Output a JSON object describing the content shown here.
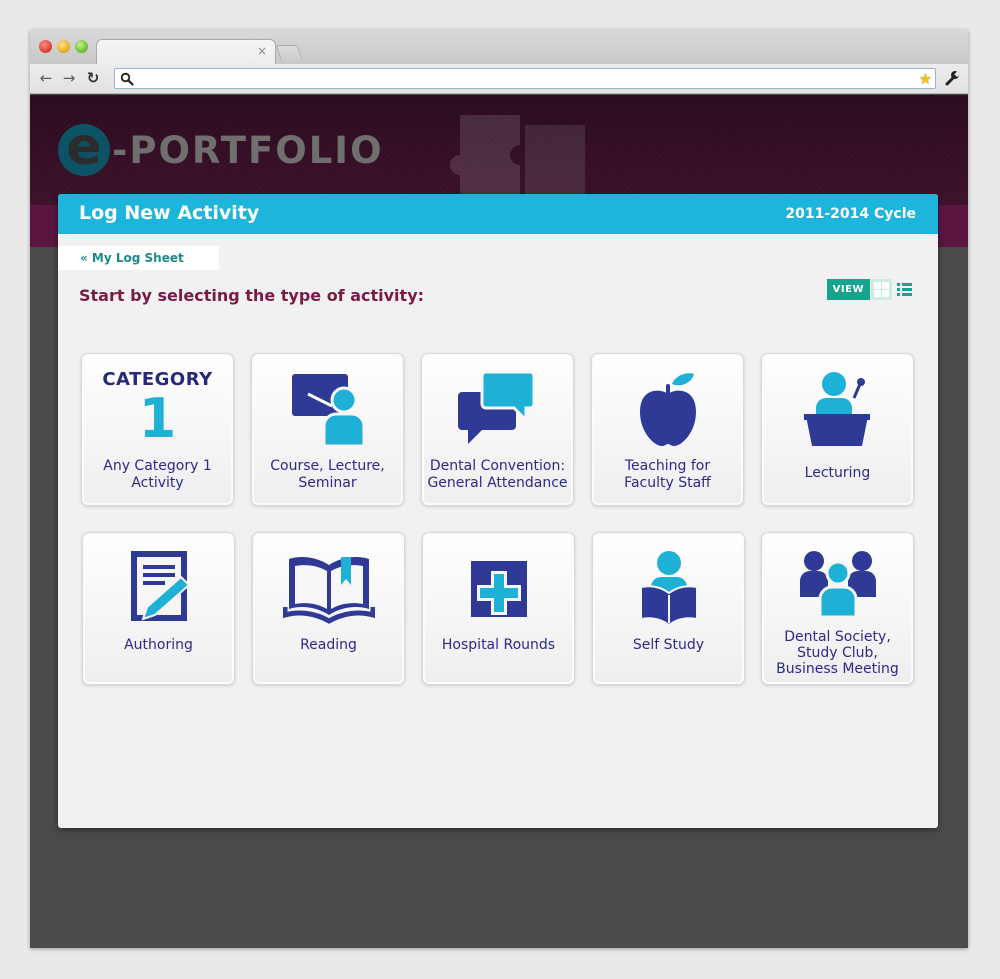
{
  "browser": {
    "tab_close": "×",
    "address": "",
    "buttons": {
      "back": "←",
      "forward": "→",
      "reload": "↻"
    },
    "star": "★"
  },
  "hero": {
    "logo_letter": "e",
    "logo_text": "-PORTFOLIO"
  },
  "panel": {
    "title": "Log New Activity",
    "cycle": "2011-2014 Cycle",
    "back_link": "« My Log Sheet",
    "prompt": "Start by selecting the type of activity:",
    "view_label": "VIEW"
  },
  "activities": [
    {
      "category_word": "CATEGORY",
      "category_number": "1",
      "label": "Any Category 1\nActivity",
      "icon": "category-1-icon"
    },
    {
      "label": "Course, Lecture,\nSeminar",
      "icon": "presenter-board-icon"
    },
    {
      "label": "Dental Convention:\nGeneral Attendance",
      "icon": "speech-bubbles-icon"
    },
    {
      "label": "Teaching for\nFaculty Staff",
      "icon": "apple-icon"
    },
    {
      "label": "Lecturing",
      "icon": "podium-icon"
    },
    {
      "label": "Authoring",
      "icon": "document-pencil-icon"
    },
    {
      "label": "Reading",
      "icon": "open-book-icon"
    },
    {
      "label": "Hospital Rounds",
      "icon": "medical-cross-icon"
    },
    {
      "label": "Self Study",
      "icon": "person-reading-icon"
    },
    {
      "label": "Dental Society,\nStudy Club,\nBusiness Meeting",
      "icon": "group-icon"
    }
  ],
  "colors": {
    "header_blue": "#1db5dc",
    "icon_navy": "#2e3a96",
    "icon_cyan": "#1fb0d6",
    "label_navy": "#2a2a8a",
    "prompt_maroon": "#7a1a45",
    "view_teal": "#17a38d"
  }
}
